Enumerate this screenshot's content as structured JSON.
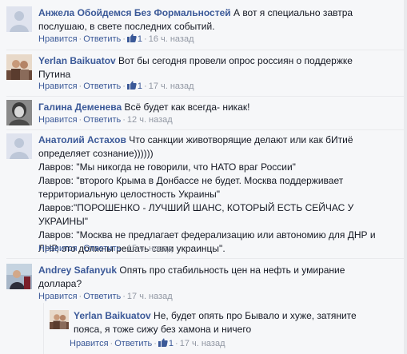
{
  "comments": [
    {
      "author": "Анжела Обойдемся Без Формальностей",
      "text_lines": [
        " А вот я специально завтра",
        "послушаю, в свете последних событий."
      ],
      "like_label": "Нравится",
      "reply_label": "Ответить",
      "likes": "1",
      "time": "16 ч. назад"
    },
    {
      "author": "Yerlan Baikuatov",
      "text_lines": [
        " Вот бы сегодня провели опрос россиян о поддержке",
        "Путина"
      ],
      "like_label": "Нравится",
      "reply_label": "Ответить",
      "likes": "1",
      "time": "17 ч. назад"
    },
    {
      "author": "Галина Деменева",
      "text_lines": [
        " Всё будет как всегда- никак!"
      ],
      "like_label": "Нравится",
      "reply_label": "Ответить",
      "time": "12 ч. назад"
    },
    {
      "author": "Анатолий Астахов",
      "text_lines": [
        " Что санкции животворящие делают или как бИтиё",
        "определяет сознание))))))",
        "Лавров: \"Мы никогда не говорили, что НАТО враг России\"",
        "Лавров: \"второго Крыма в Донбассе не будет. Москва поддерживает",
        "территориальную целостность Украины\"",
        "Лавров:\"ПОРОШЕНКО - ЛУЧШИЙ ШАНС, КОТОРЫЙ ЕСТЬ СЕЙЧАС У",
        "УКРАИНЫ\"",
        "Лавров: \"Москва не предлагает федерализацию или автономию для ДНР и",
        "ЛНР, это должны решать сами украинцы\"."
      ],
      "like_label": "Нравится",
      "reply_label": "Ответить",
      "time": "15 ч. назад"
    },
    {
      "author": "Andrey Safanyuk",
      "text_lines": [
        " Опять про стабильность цен на нефть и умирание",
        "доллара?"
      ],
      "like_label": "Нравится",
      "reply_label": "Ответить",
      "time": "17 ч. назад"
    },
    {
      "author": "Yerlan Baikuatov",
      "text_lines": [
        " Не, будет опять про Бывало и хуже, затяните",
        "пояса, я тоже сижу без хамона и ничего"
      ],
      "like_label": "Нравится",
      "reply_label": "Ответить",
      "likes": "1",
      "time": "17 ч. назад"
    }
  ],
  "separator": "·",
  "colors": {
    "link": "#3b5998",
    "meta": "#9197a3",
    "text": "#141823",
    "background": "#f6f7f9"
  },
  "icons": {
    "like": "thumbs-up-icon"
  }
}
